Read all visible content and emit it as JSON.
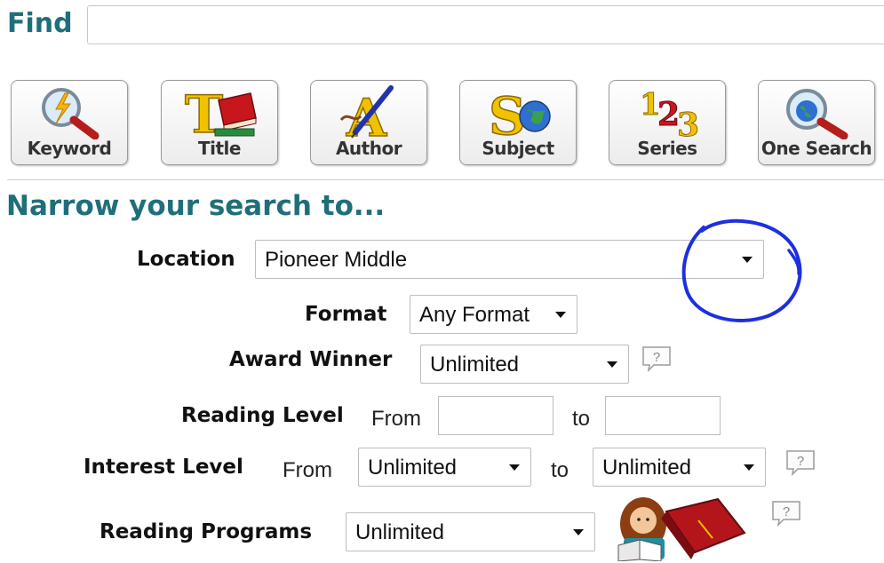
{
  "find": {
    "label": "Find",
    "value": ""
  },
  "search_buttons": [
    {
      "label": "Keyword",
      "icon": "magnifier-lightning-icon"
    },
    {
      "label": "Title",
      "icon": "title-book-icon"
    },
    {
      "label": "Author",
      "icon": "author-quill-icon"
    },
    {
      "label": "Subject",
      "icon": "subject-globe-icon"
    },
    {
      "label": "Series",
      "icon": "series-numbers-icon"
    },
    {
      "label": "One Search",
      "icon": "magnifier-globe-icon"
    }
  ],
  "narrow": {
    "heading": "Narrow your search to...",
    "location": {
      "label": "Location",
      "value": "Pioneer Middle"
    },
    "format": {
      "label": "Format",
      "value": "Any Format"
    },
    "award_winner": {
      "label": "Award Winner",
      "value": "Unlimited",
      "help": "?"
    },
    "reading_level": {
      "label": "Reading Level",
      "from": "From",
      "to": "to",
      "from_value": "",
      "to_value": ""
    },
    "interest_level": {
      "label": "Interest Level",
      "from": "From",
      "to": "to",
      "from_value": "Unlimited",
      "to_value": "Unlimited",
      "help": "?"
    },
    "reading_programs": {
      "label": "Reading Programs",
      "value": "Unlimited",
      "help": "?",
      "icon": "reading-kid-book-icon"
    }
  },
  "colors": {
    "heading": "#1f6f7a",
    "annotation": "#1d2fe0"
  }
}
